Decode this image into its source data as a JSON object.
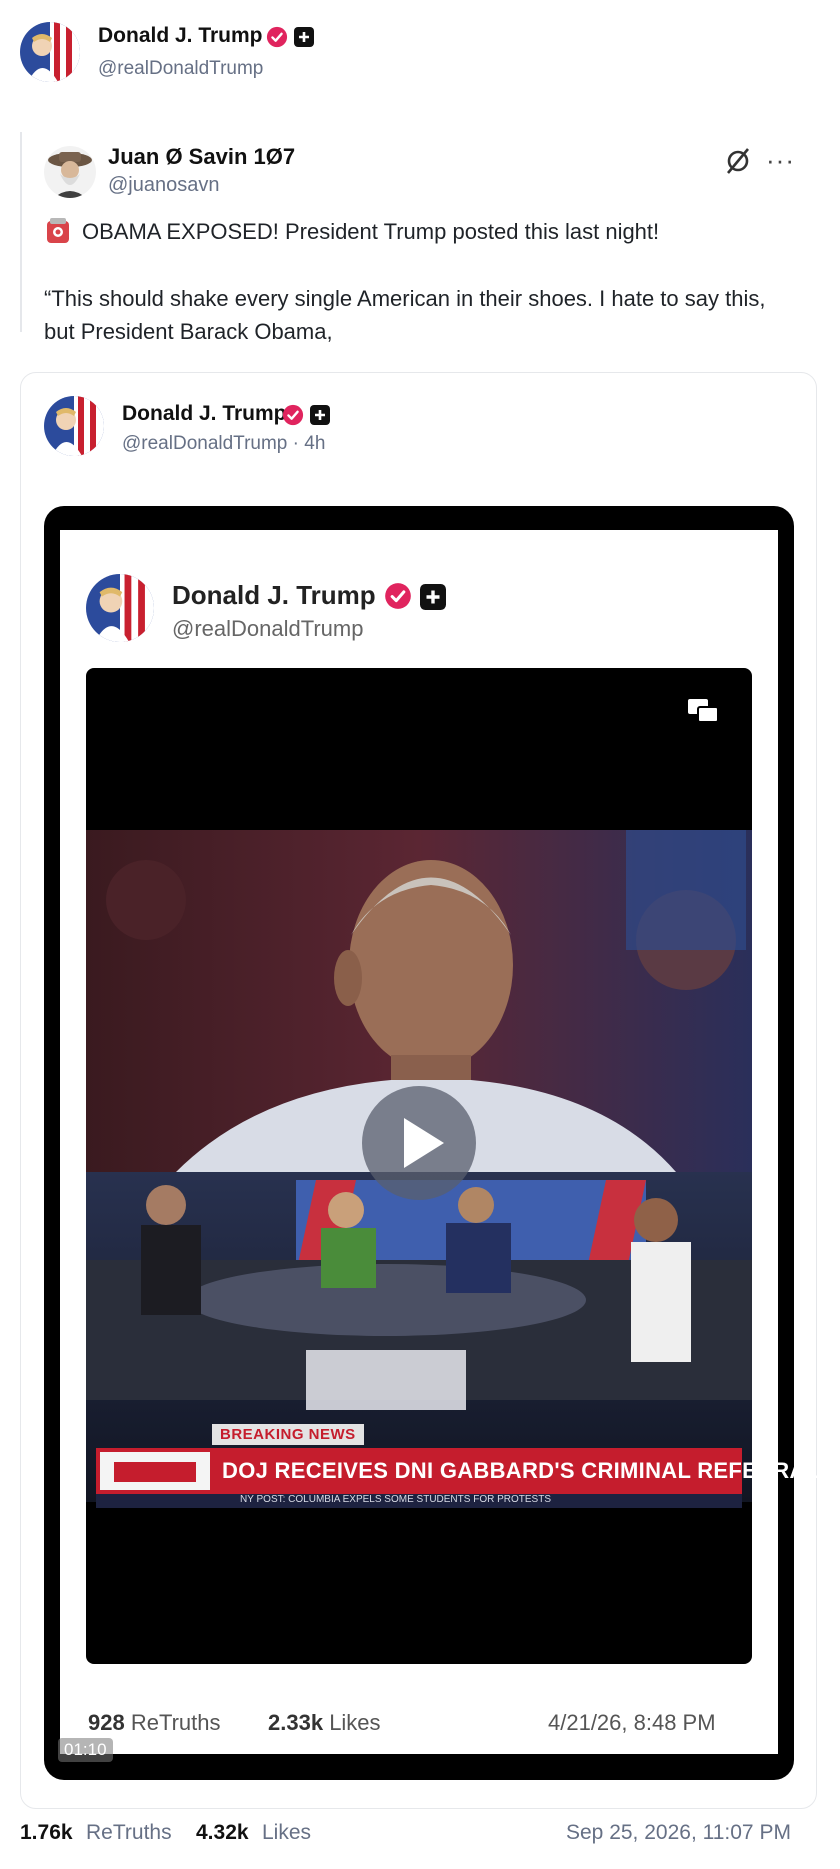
{
  "post": {
    "author_name": "Donald J. Trump",
    "author_handle": "@realDonaldTrump",
    "retruths_count": "1.76k",
    "retruths_label": "ReTruths",
    "likes_count": "4.32k",
    "likes_label": "Likes",
    "date": "Sep 25, 2026, 11:07 PM"
  },
  "quoted": {
    "author_name": "Juan Ø Savin 1Ø7",
    "author_handle": "@juanosavn",
    "line1": "OBAMA EXPOSED!  President Trump posted this last night!",
    "body": "“This should shake every single American in their shoes. I hate to say this, but President Barack Obama,"
  },
  "embedded": {
    "author_name": "Donald J. Trump",
    "author_handle": "@realDonaldTrump · 4h",
    "video_timestamp": "01:10"
  },
  "screenshot": {
    "author_name": "Donald J. Trump",
    "author_handle": "@realDonaldTrump",
    "retruths_count": "928",
    "retruths_label": "ReTruths",
    "likes_count": "2.33k",
    "likes_label": "Likes",
    "date": "4/21/26, 8:48 PM",
    "breaking_label": "BREAKING NEWS",
    "chyron": "DOJ RECEIVES DNI GABBARD'S CRIMINAL REFERRAL",
    "ticker": "NY POST: COLUMBIA EXPELS SOME STUDENTS FOR PROTESTS"
  },
  "colors": {
    "verified": "#e0245e",
    "chyron_red": "#c51d2d",
    "muted": "#667085"
  },
  "icons": [
    "verified-icon",
    "plus-badge-icon",
    "null-icon",
    "more-icon",
    "alert-icon",
    "play-icon",
    "screen-toggle-icon"
  ]
}
